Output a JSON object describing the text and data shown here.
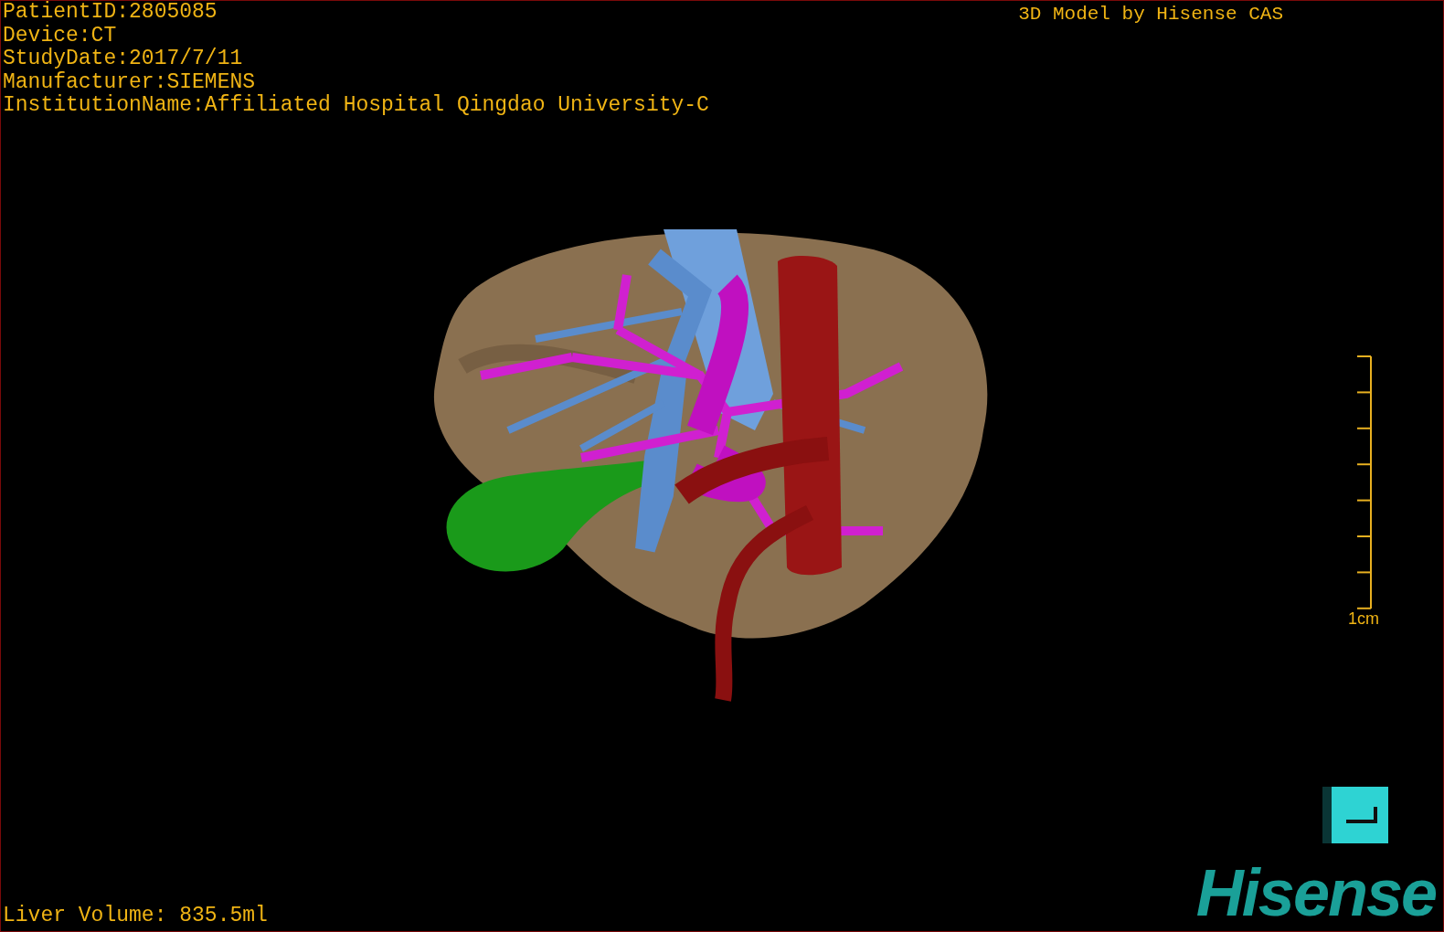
{
  "patient_info": [
    "PatientID:2805085",
    "Device:CT",
    "StudyDate:2017/7/11",
    "Manufacturer:SIEMENS",
    "InstitutionName:Affiliated Hospital Qingdao University-C"
  ],
  "title": "3D Model by Hisense CAS",
  "scale": {
    "label": "1cm"
  },
  "liver_volume": "Liver Volume: 835.5ml",
  "logo": "Hisense"
}
